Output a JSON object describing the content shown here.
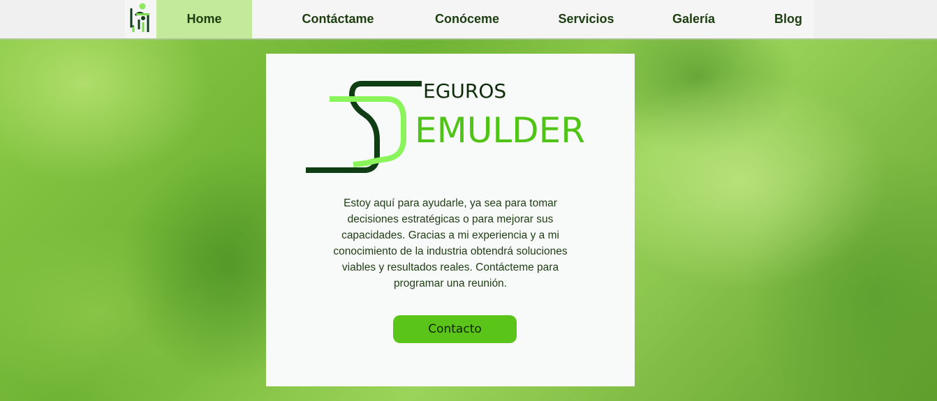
{
  "nav": {
    "items": [
      {
        "label": "Home",
        "active": true
      },
      {
        "label": "Contáctame",
        "active": false
      },
      {
        "label": "Conóceme",
        "active": false
      },
      {
        "label": "Servicios",
        "active": false
      },
      {
        "label": "Galería",
        "active": false
      },
      {
        "label": "Blog",
        "active": false
      }
    ]
  },
  "logo": {
    "icon": "person-desk-logo-icon"
  },
  "brand": {
    "line1": "EGUROS",
    "line2": "EMULDER"
  },
  "intro": {
    "text": "Estoy aquí para ayudarle, ya sea para tomar decisiones estratégicas o para mejorar sus capacidades. Gracias a mi experiencia y a mi conocimiento de la industria obtendrá soluciones viables y resultados reales. Contácteme para programar una reunión."
  },
  "cta": {
    "label": "Contacto"
  },
  "colors": {
    "accent": "#5ac418",
    "nav_active": "#c3ea9a",
    "dark_green": "#0f3d14",
    "light_green": "#8af55a",
    "text": "#1e3d12"
  }
}
